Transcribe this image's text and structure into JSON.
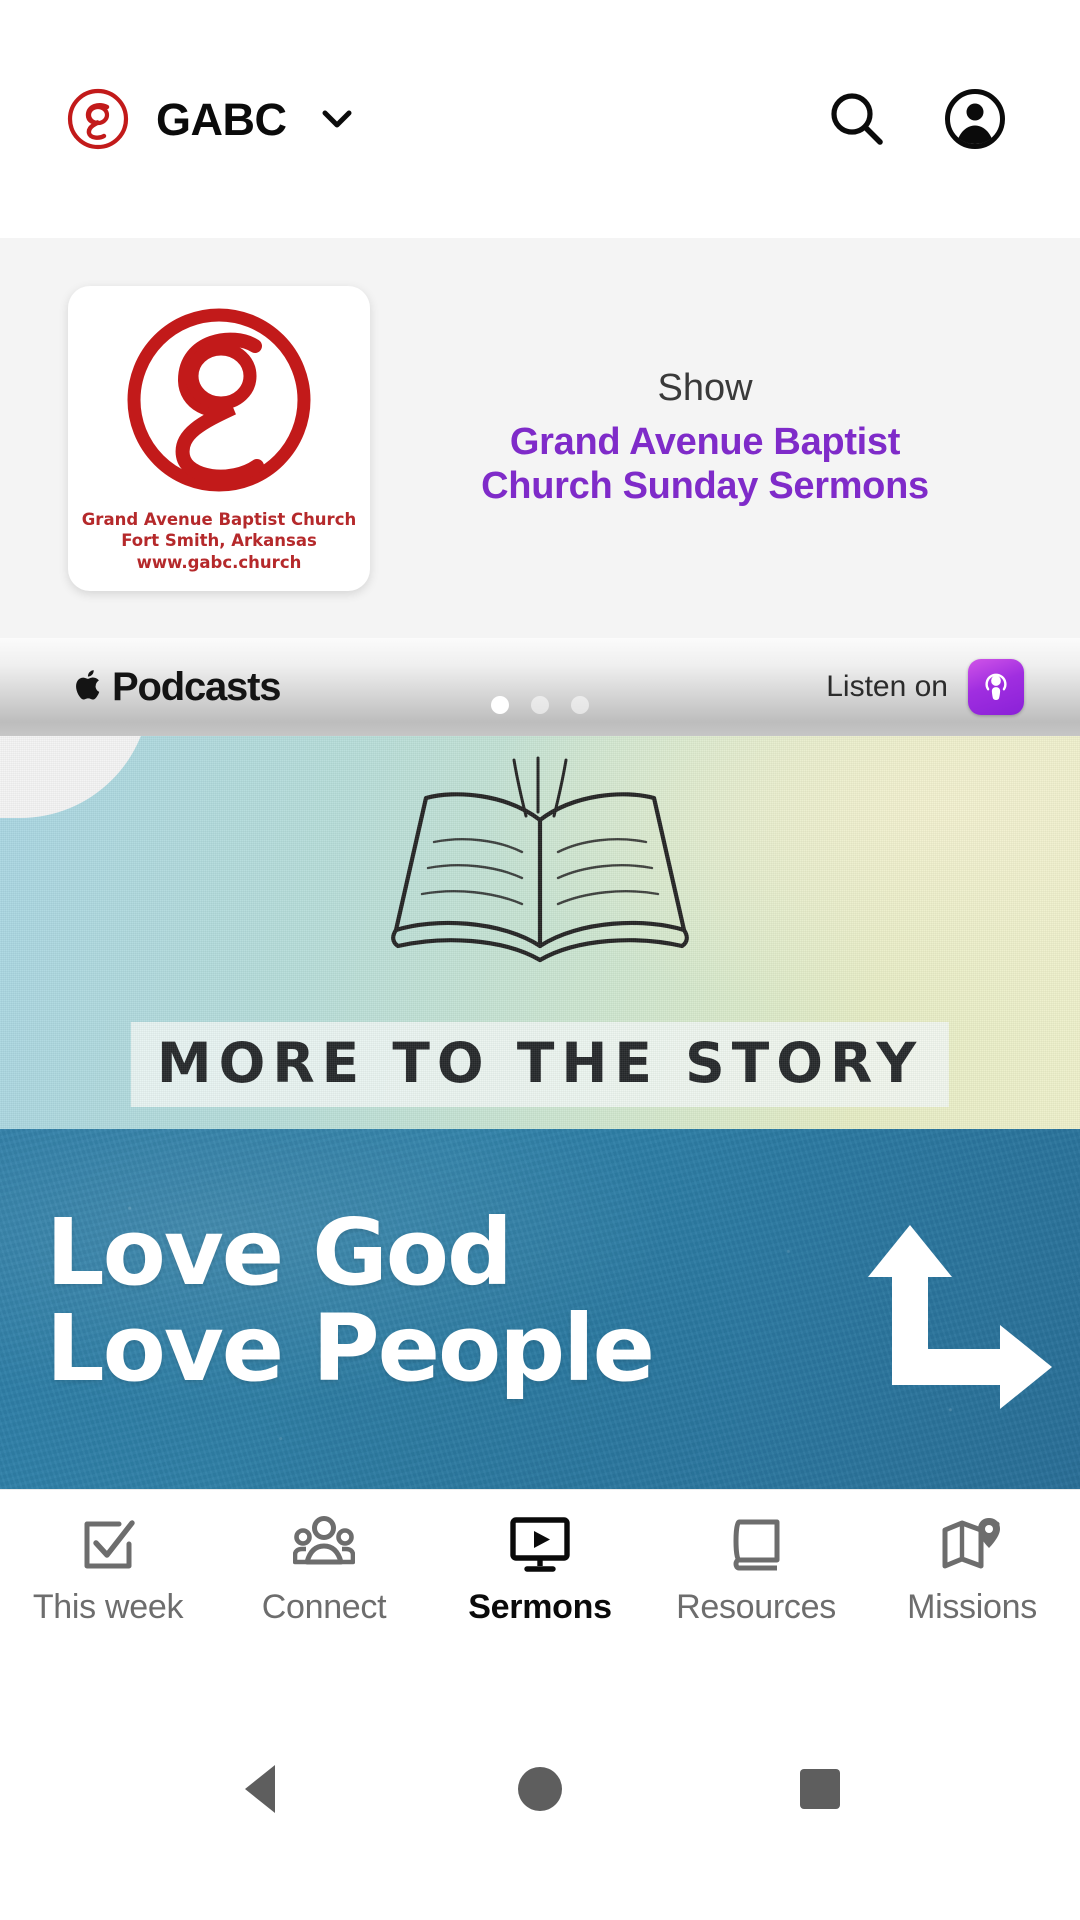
{
  "header": {
    "brand_label": "GABC",
    "logo_icon": "gabc-g-logo",
    "dropdown_icon": "chevron-down-icon",
    "search_icon": "search-icon",
    "account_icon": "account-circle-icon",
    "logo_color": "#c21a1a"
  },
  "promo": {
    "artwork": {
      "logo_icon": "gabc-g-logo",
      "caption_line1": "Grand Avenue Baptist Church",
      "caption_line2": "Fort Smith, Arkansas",
      "caption_line3": "www.gabc.church",
      "caption_color": "#b5292b"
    },
    "kicker": "Show",
    "title_line1": "Grand Avenue Baptist",
    "title_line2": "Church Sunday Sermons",
    "title_color": "#7f2bc9"
  },
  "podcast_bar": {
    "apple_icon": "apple-logo-icon",
    "platform_label": "Podcasts",
    "listen_label": "Listen on",
    "app_icon": "apple-podcasts-app-icon",
    "app_icon_color": "#a02ee0",
    "carousel": {
      "total": 3,
      "active_index": 0
    }
  },
  "banners": [
    {
      "name": "more-to-the-story",
      "illustration_icon": "open-book-illustration",
      "headline": "MORE TO THE STORY"
    },
    {
      "name": "love-god-love-people",
      "headline_line1": "Love God",
      "headline_line2": "Love People",
      "graphic_icon": "up-right-arrow-graphic",
      "background_color": "#2f7fa8"
    }
  ],
  "tabbar": {
    "items": [
      {
        "label": "This week",
        "icon": "checkbox-check-icon",
        "active": false
      },
      {
        "label": "Connect",
        "icon": "people-group-icon",
        "active": false
      },
      {
        "label": "Sermons",
        "icon": "tv-play-icon",
        "active": true
      },
      {
        "label": "Resources",
        "icon": "book-icon",
        "active": false
      },
      {
        "label": "Missions",
        "icon": "map-pin-icon",
        "active": false
      }
    ]
  },
  "system_nav": {
    "back_icon": "back-triangle-icon",
    "home_icon": "home-circle-icon",
    "recents_icon": "recents-square-icon"
  }
}
